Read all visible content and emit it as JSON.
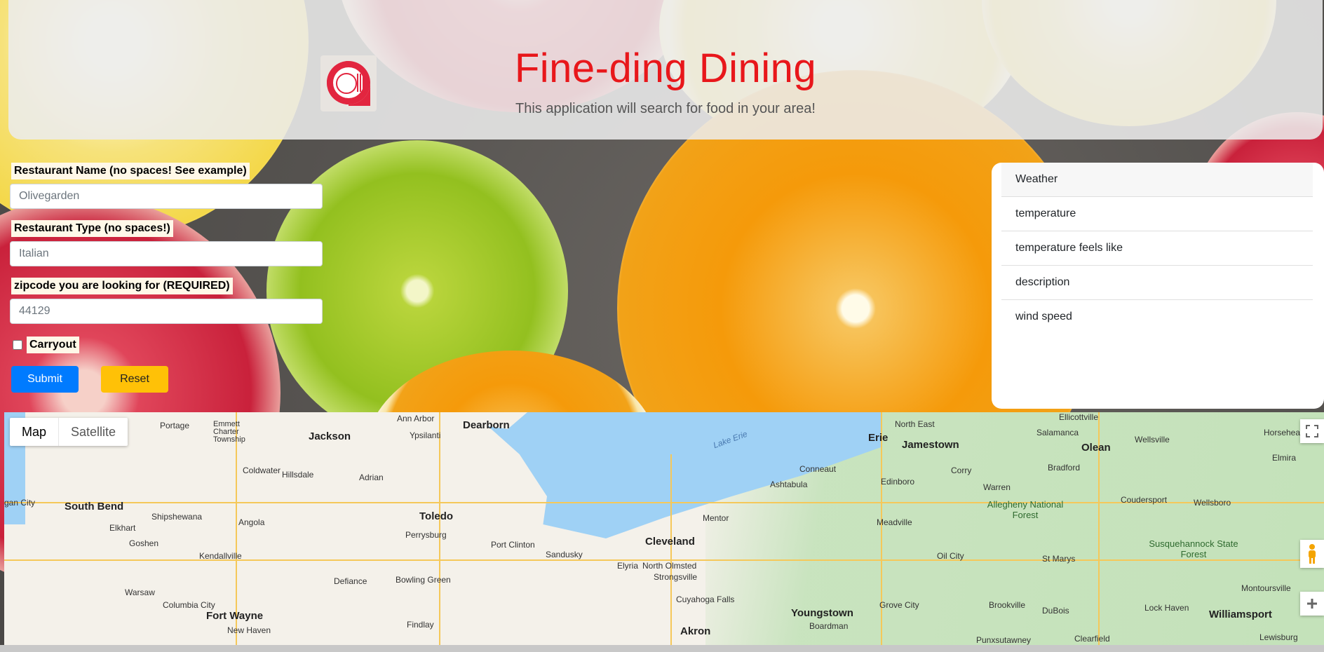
{
  "header": {
    "title": "Fine-ding Dining",
    "subtitle": "This application will search for food in your area!"
  },
  "form": {
    "name_label": "Restaurant Name (no spaces! See example)",
    "name_placeholder": "Olivegarden",
    "type_label": "Restaurant Type (no spaces!)",
    "type_placeholder": "Italian",
    "zip_label": "zipcode you are looking for (REQUIRED)",
    "zip_placeholder": "44129",
    "carryout_label": "Carryout",
    "carryout_checked": false,
    "submit_label": "Submit",
    "reset_label": "Reset"
  },
  "weather": {
    "items": [
      "Weather",
      "temperature",
      "temperature feels like",
      "description",
      "wind speed"
    ]
  },
  "map": {
    "tabs": [
      "Map",
      "Satellite"
    ],
    "active_tab": "Map",
    "lake_label": "Lake Erie",
    "cities": {
      "cleveland": "Cleveland",
      "toledo": "Toledo",
      "erie": "Erie",
      "akron": "Akron",
      "youngstown": "Youngstown",
      "elyria": "Elyria",
      "sandusky": "Sandusky",
      "fort_wayne": "Fort Wayne",
      "south_bend": "South Bend",
      "jackson": "Jackson",
      "ann_arbor": "Ann Arbor",
      "dearborn": "Dearborn",
      "elkhart": "Elkhart",
      "angola": "Angola",
      "adrian": "Adrian",
      "hillsdale": "Hillsdale",
      "coldwater": "Coldwater",
      "findlay": "Findlay",
      "defiance": "Defiance",
      "bowling_green": "Bowling Green",
      "perrysburg": "Perrysburg",
      "port_clinton": "Port Clinton",
      "north_olmsted": "North Olmsted",
      "strongsville": "Strongsville",
      "cuyahoga_falls": "Cuyahoga Falls",
      "boardman": "Boardman",
      "mentor": "Mentor",
      "ashtabula": "Ashtabula",
      "conneaut": "Conneaut",
      "meadville": "Meadville",
      "edinboro": "Edinboro",
      "oil_city": "Oil City",
      "grove_city": "Grove City",
      "warren": "Warren",
      "jamestown": "Jamestown",
      "bradford": "Bradford",
      "olean": "Olean",
      "salamanca": "Salamanca",
      "wellsville": "Wellsville",
      "coudersport": "Coudersport",
      "wellsboro": "Wellsboro",
      "elmira": "Elmira",
      "st_marys": "St Marys",
      "brookville": "Brookville",
      "dubois": "DuBois",
      "clearfield": "Clearfield",
      "lock_haven": "Lock Haven",
      "williamsport": "Williamsport",
      "montoursville": "Montoursville",
      "north_east": "North East",
      "corry": "Corry",
      "kendallville": "Kendallville",
      "goshen": "Goshen",
      "shipshewana": "Shipshewana",
      "warsaw": "Warsaw",
      "columbia_city": "Columbia City",
      "new_haven": "New Haven",
      "portage": "Portage",
      "emmett_charter_township": "Emmett Charter Township",
      "ypsilanti": "Ypsilanti",
      "punxsutawney": "Punxsutawney",
      "lewisburg": "Lewisburg",
      "horseheads": "Horseheads",
      "ellicottville": "Ellicottville",
      "gan_city": "gan City"
    },
    "forests": {
      "allegheny": "Allegheny National Forest",
      "susquehannock": "Susquehannock State Forest"
    }
  }
}
